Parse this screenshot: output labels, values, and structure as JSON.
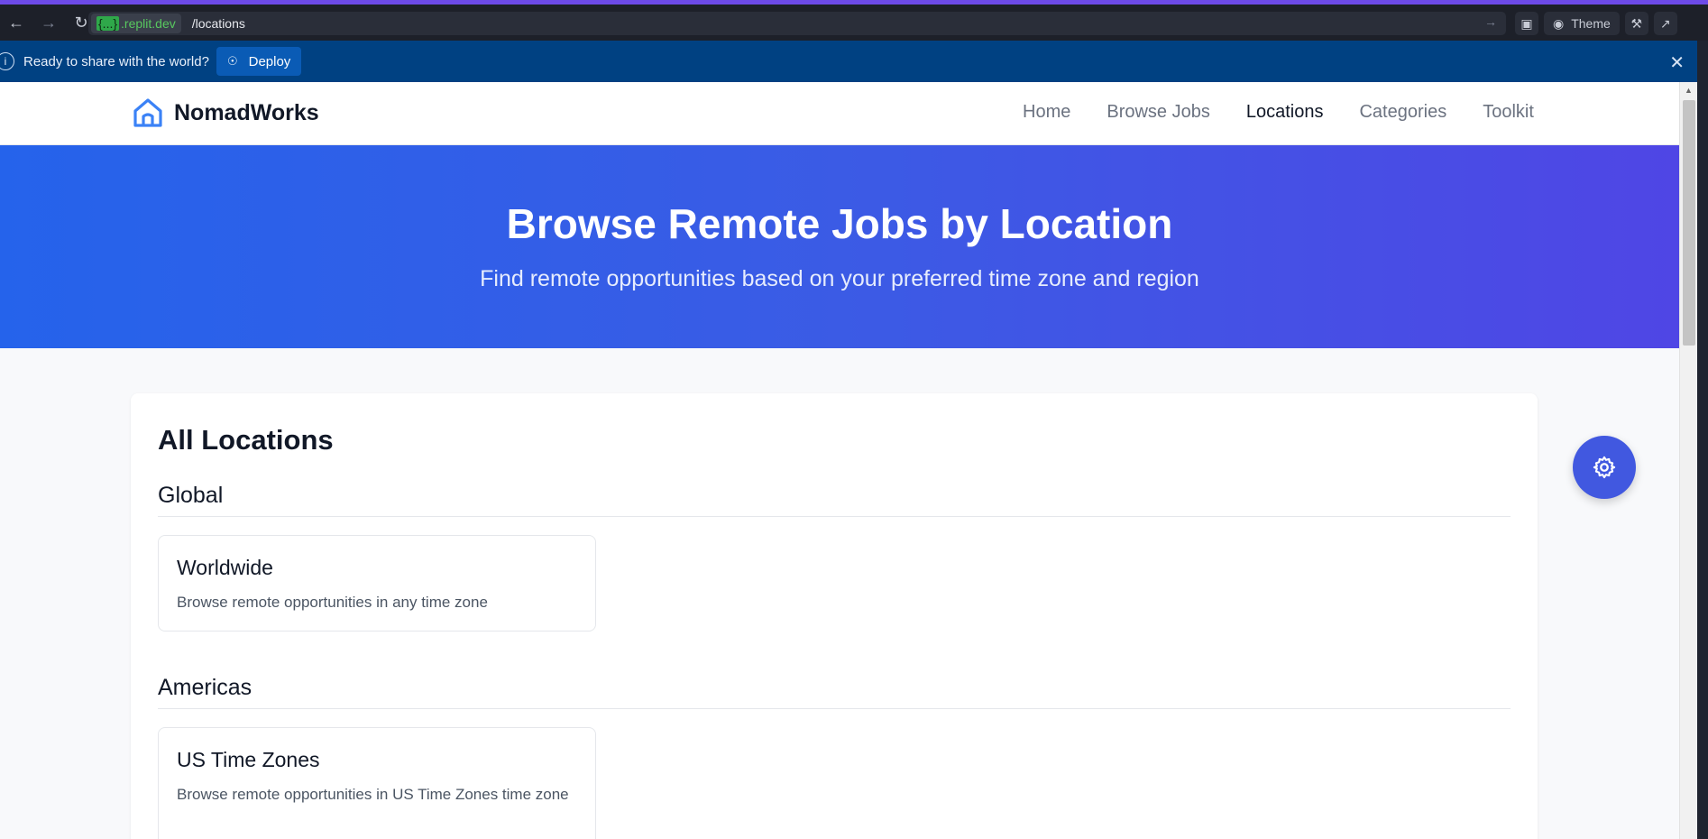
{
  "browser": {
    "host_brace": "{...}",
    "host_domain": ".replit.dev",
    "path": "/locations",
    "theme_label": "Theme"
  },
  "banner": {
    "message": "Ready to share with the world?",
    "deploy_label": "Deploy"
  },
  "site": {
    "brand": "NomadWorks",
    "nav": [
      "Home",
      "Browse Jobs",
      "Locations",
      "Categories",
      "Toolkit"
    ],
    "active_nav": "Locations"
  },
  "hero": {
    "title": "Browse Remote Jobs by Location",
    "subtitle": "Find remote opportunities based on your preferred time zone and region"
  },
  "locations": {
    "heading": "All Locations",
    "regions": [
      {
        "name": "Global",
        "items": [
          {
            "title": "Worldwide",
            "description": "Browse remote opportunities in any time zone"
          }
        ]
      },
      {
        "name": "Americas",
        "items": [
          {
            "title": "US Time Zones",
            "description": "Browse remote opportunities in US Time Zones time zone"
          }
        ]
      }
    ]
  },
  "colors": {
    "hero_start": "#2563eb",
    "hero_end": "#4f46e5",
    "banner": "#004182",
    "accent": "#4158e0"
  },
  "icons": {
    "logo": "house-icon",
    "fab": "gear-icon"
  }
}
